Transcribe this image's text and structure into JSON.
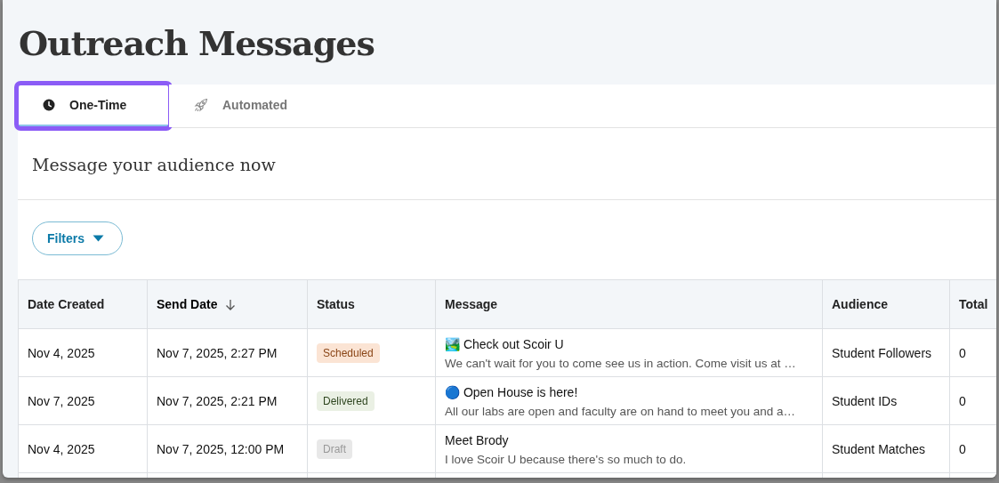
{
  "page": {
    "title": "Outreach Messages"
  },
  "tabs": [
    {
      "label": "One-Time",
      "selected": true,
      "focused": true
    },
    {
      "label": "Automated",
      "selected": false,
      "focused": false
    }
  ],
  "section": {
    "heading": "Message your audience now"
  },
  "filters_button": {
    "label": "Filters"
  },
  "table": {
    "columns": [
      {
        "label": "Date Created",
        "sorted": false
      },
      {
        "label": "Send Date",
        "sorted": true
      },
      {
        "label": "Status",
        "sorted": false
      },
      {
        "label": "Message",
        "sorted": false
      },
      {
        "label": "Audience",
        "sorted": false
      },
      {
        "label": "Total",
        "sorted": false
      }
    ],
    "rows": [
      {
        "date_created": "Nov 4, 2025",
        "send_date": "Nov 7, 2025, 2:27 PM",
        "status": {
          "label": "Scheduled",
          "kind": "scheduled"
        },
        "message_title": "🏞️ Check out Scoir U",
        "message_body": "We can't wait for you to come see us in action. Come visit us at …",
        "audience": "Student Followers",
        "total": "0"
      },
      {
        "date_created": "Nov 7, 2025",
        "send_date": "Nov 7, 2025, 2:21 PM",
        "status": {
          "label": "Delivered",
          "kind": "delivered"
        },
        "message_title": "🔵 Open House is here!",
        "message_body": "All our labs are open and faculty are on hand to meet you and a…",
        "audience": "Student IDs",
        "total": "0"
      },
      {
        "date_created": "Nov 4, 2025",
        "send_date": "Nov 7, 2025, 12:00 PM",
        "status": {
          "label": "Draft",
          "kind": "draft"
        },
        "message_title": "Meet Brody",
        "message_body": "I love Scoir U because there's so much to do.",
        "audience": "Student Matches",
        "total": "0"
      }
    ]
  }
}
